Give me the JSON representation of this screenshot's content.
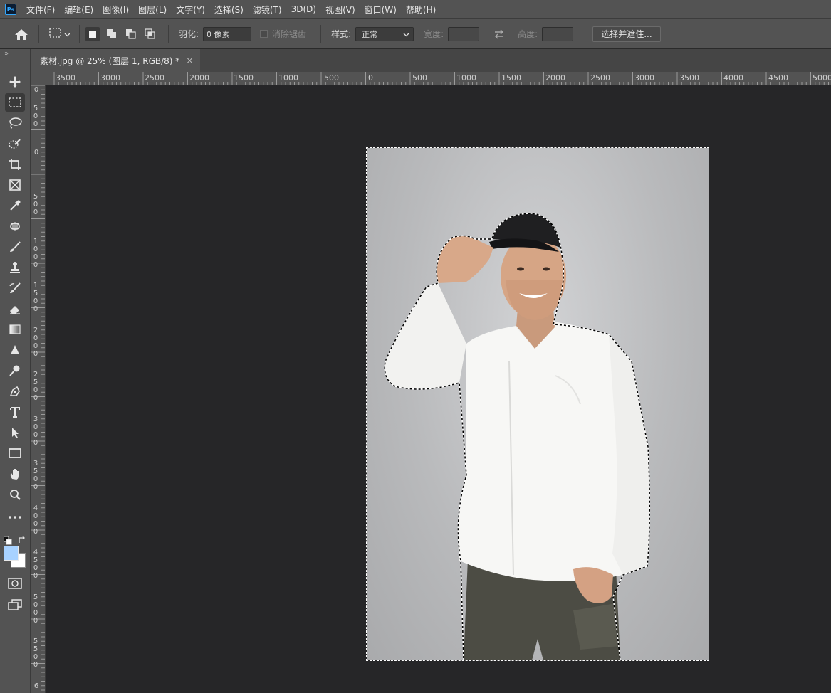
{
  "menu": {
    "logo": "Ps",
    "items": [
      "文件(F)",
      "编辑(E)",
      "图像(I)",
      "图层(L)",
      "文字(Y)",
      "选择(S)",
      "滤镜(T)",
      "3D(D)",
      "视图(V)",
      "窗口(W)",
      "帮助(H)"
    ]
  },
  "options": {
    "feather_label": "羽化:",
    "feather_value": "0 像素",
    "antialias_label": "消除锯齿",
    "style_label": "样式:",
    "style_value": "正常",
    "width_label": "宽度:",
    "height_label": "高度:",
    "select_mask_label": "选择并遮住..."
  },
  "document": {
    "tab_title": "素材.jpg @ 25% (图层 1, RGB/8) *",
    "close": "×"
  },
  "rulers": {
    "top_labels": [
      "3500",
      "3000",
      "2500",
      "2000",
      "1500",
      "1000",
      "500",
      "0",
      "500",
      "1000",
      "1500",
      "2000",
      "2500",
      "3000",
      "3500",
      "4000",
      "4500",
      "5000"
    ],
    "left_labels": [
      "0",
      "500",
      "0",
      "500",
      "1000",
      "1500",
      "2000",
      "2500",
      "3000",
      "3500",
      "4000",
      "4500",
      "5000",
      "5500",
      "6"
    ]
  },
  "toolbar": {
    "collapse": "»",
    "tools": [
      "move-tool",
      "marquee-tool",
      "lasso-tool",
      "quick-select-tool",
      "crop-tool",
      "frame-tool",
      "eyedropper-tool",
      "healing-tool",
      "brush-tool",
      "stamp-tool",
      "history-brush-tool",
      "eraser-tool",
      "gradient-tool",
      "blur-tool",
      "dodge-tool",
      "pen-tool",
      "type-tool",
      "path-select-tool",
      "rectangle-tool",
      "hand-tool",
      "zoom-tool",
      "more-tools"
    ]
  },
  "colors": {
    "foreground": "#a8d2ff",
    "background": "#ffffff",
    "accent": "#31a8ff"
  }
}
